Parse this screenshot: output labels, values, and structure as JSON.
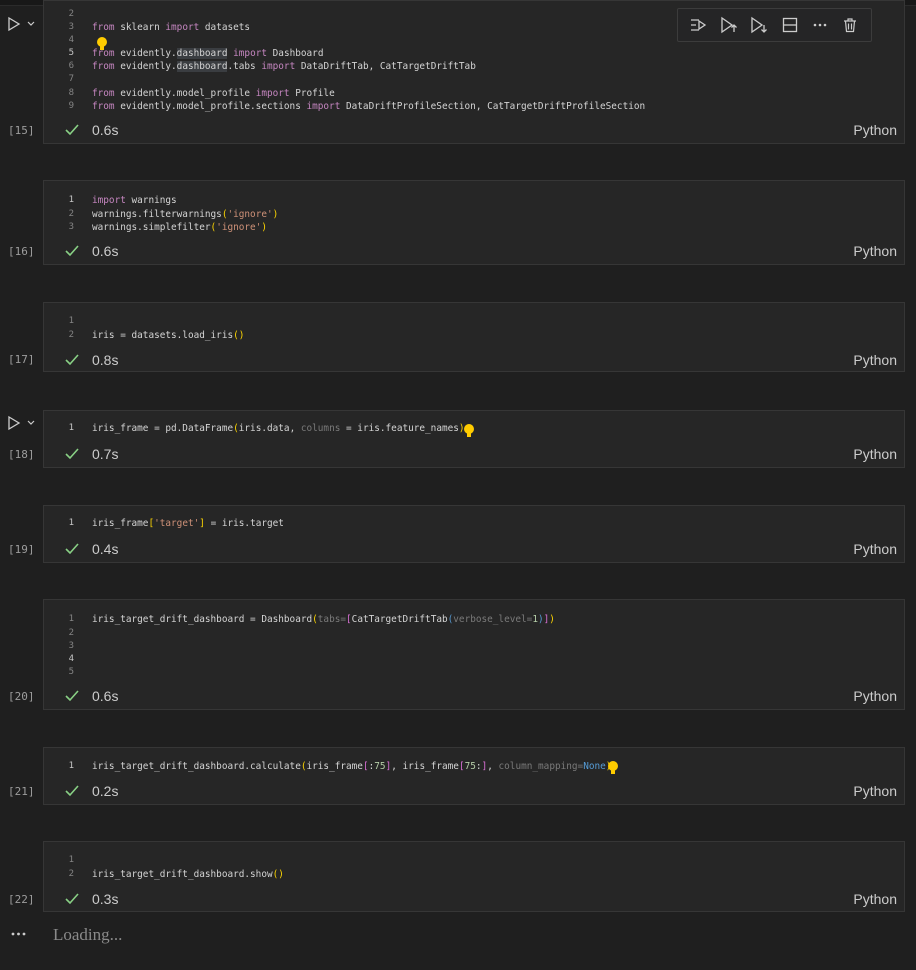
{
  "language": "Python",
  "output": {
    "loading_text": "Loading..."
  },
  "cells": [
    {
      "exec_count": "[15]",
      "time": "0.6s",
      "lines": [
        {
          "n": "2",
          "code": ""
        },
        {
          "n": "3",
          "code": "from sklearn import datasets"
        },
        {
          "n": "4",
          "code": ""
        },
        {
          "n": "5",
          "code": "from evidently.dashboard import Dashboard"
        },
        {
          "n": "6",
          "code": "from evidently.dashboard.tabs import DataDriftTab, CatTargetDriftTab"
        },
        {
          "n": "7",
          "code": ""
        },
        {
          "n": "8",
          "code": "from evidently.model_profile import Profile"
        },
        {
          "n": "9",
          "code": "from evidently.model_profile.sections import DataDriftProfileSection, CatTargetDriftProfileSection"
        }
      ]
    },
    {
      "exec_count": "[16]",
      "time": "0.6s",
      "lines": [
        {
          "n": "1",
          "code": "import warnings"
        },
        {
          "n": "2",
          "code": "warnings.filterwarnings('ignore')"
        },
        {
          "n": "3",
          "code": "warnings.simplefilter('ignore')"
        }
      ]
    },
    {
      "exec_count": "[17]",
      "time": "0.8s",
      "lines": [
        {
          "n": "1",
          "code": ""
        },
        {
          "n": "2",
          "code": "iris = datasets.load_iris()"
        }
      ]
    },
    {
      "exec_count": "[18]",
      "time": "0.7s",
      "lines": [
        {
          "n": "1",
          "code": "iris_frame = pd.DataFrame(iris.data, columns = iris.feature_names)"
        }
      ]
    },
    {
      "exec_count": "[19]",
      "time": "0.4s",
      "lines": [
        {
          "n": "1",
          "code": "iris_frame['target'] = iris.target"
        }
      ]
    },
    {
      "exec_count": "[20]",
      "time": "0.6s",
      "lines": [
        {
          "n": "1",
          "code": "iris_target_drift_dashboard = Dashboard(tabs=[CatTargetDriftTab(verbose_level=1)])"
        },
        {
          "n": "2",
          "code": ""
        },
        {
          "n": "3",
          "code": ""
        },
        {
          "n": "4",
          "code": ""
        },
        {
          "n": "5",
          "code": ""
        }
      ]
    },
    {
      "exec_count": "[21]",
      "time": "0.2s",
      "lines": [
        {
          "n": "1",
          "code": "iris_target_drift_dashboard.calculate(iris_frame[:75], iris_frame[75:], column_mapping=None)"
        }
      ]
    },
    {
      "exec_count": "[22]",
      "time": "0.3s",
      "lines": [
        {
          "n": "1",
          "code": ""
        },
        {
          "n": "2",
          "code": "iris_target_drift_dashboard.show()"
        }
      ]
    }
  ],
  "toolbar": {
    "icons": [
      "run-by-line-icon",
      "execute-above-icon",
      "execute-below-icon",
      "split-cell-icon",
      "more-actions-icon",
      "delete-cell-icon"
    ]
  },
  "colors": {
    "background": "#1f1f1f",
    "cell_bg": "#262626",
    "success": "#89d185",
    "lightbulb": "#ffcc00",
    "keyword": "#569cd6",
    "string": "#ce9178"
  }
}
